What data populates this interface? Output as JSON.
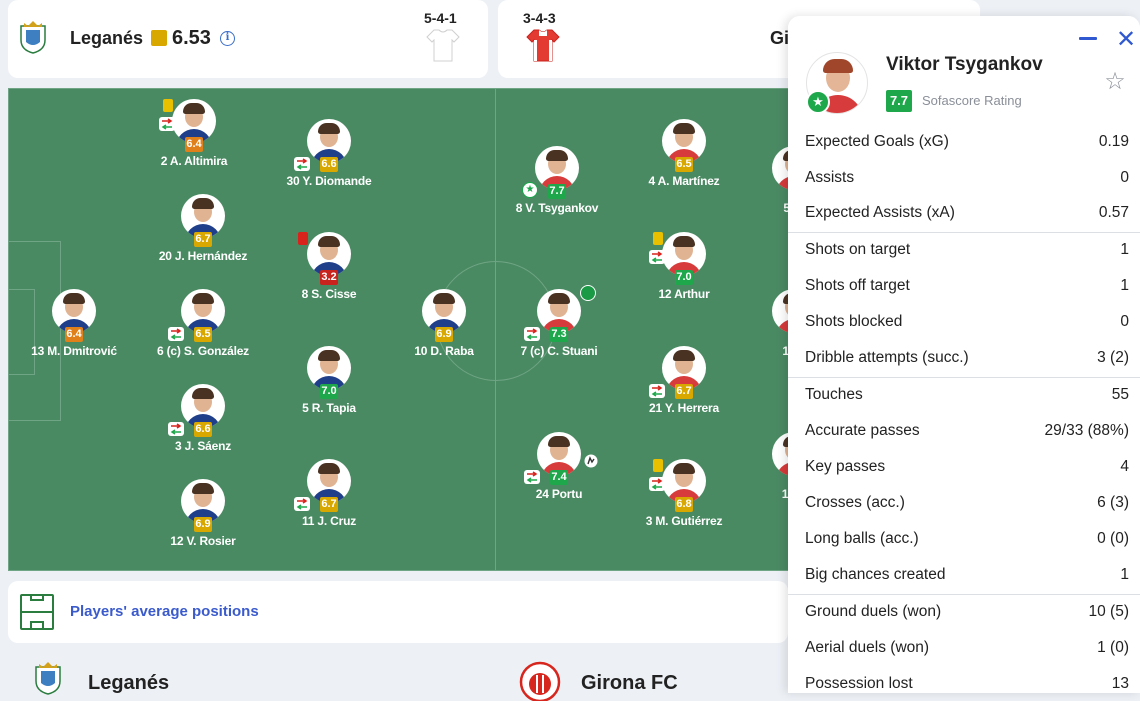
{
  "team_left": {
    "name": "Leganés",
    "rating": "6.53",
    "formation": "5-4-1"
  },
  "team_right": {
    "name_partial": "Gi",
    "formation": "3-4-3"
  },
  "colors": {
    "pitch": "#4a8a63",
    "rating_green": "#1ea84b",
    "rating_yellow": "#d8a700",
    "rating_orange": "#e0801a",
    "rating_red": "#c9231e",
    "link_blue": "#3b5bcc"
  },
  "players": [
    {
      "label": "2 A. Altimira",
      "rating": "6.4",
      "rating_color": "#e0801a",
      "icons": [
        "yellow-card",
        "substitution"
      ]
    },
    {
      "label": "30 Y. Diomande",
      "rating": "6.6",
      "rating_color": "#d8a700",
      "icons": [
        "substitution"
      ]
    },
    {
      "label": "20 J. Hernández",
      "rating": "6.7",
      "rating_color": "#d8a700",
      "icons": []
    },
    {
      "label": "8 S. Cisse",
      "rating": "3.2",
      "rating_color": "#c9231e",
      "icons": [
        "red-card"
      ]
    },
    {
      "label": "13 M. Dmitrović",
      "rating": "6.4",
      "rating_color": "#e0801a",
      "icons": []
    },
    {
      "label": "6 (c) S. González",
      "rating": "6.5",
      "rating_color": "#d8a700",
      "icons": [
        "substitution"
      ]
    },
    {
      "label": "5 R. Tapia",
      "rating": "7.0",
      "rating_color": "#1ea84b",
      "icons": []
    },
    {
      "label": "10 D. Raba",
      "rating": "6.9",
      "rating_color": "#d8a700",
      "icons": []
    },
    {
      "label": "3 J. Sáenz",
      "rating": "6.6",
      "rating_color": "#d8a700",
      "icons": [
        "substitution"
      ]
    },
    {
      "label": "11 J. Cruz",
      "rating": "6.7",
      "rating_color": "#d8a700",
      "icons": [
        "substitution"
      ]
    },
    {
      "label": "12 V. Rosier",
      "rating": "6.9",
      "rating_color": "#d8a700",
      "icons": []
    },
    {
      "label": "8 V. Tsygankov",
      "rating": "7.7",
      "rating_color": "#1ea84b",
      "icons": [
        "player-of-match"
      ]
    },
    {
      "label": "4 A. Martínez",
      "rating": "6.5",
      "rating_color": "#d8a700",
      "icons": []
    },
    {
      "label": "5 D.",
      "rating": "",
      "rating_color": "#d8a700",
      "icons": []
    },
    {
      "label": "12 Arthur",
      "rating": "7.0",
      "rating_color": "#1ea84b",
      "icons": [
        "yellow-card",
        "substitution"
      ]
    },
    {
      "label": "7 (c) C. Stuani",
      "rating": "7.3",
      "rating_color": "#1ea84b",
      "icons": [
        "substitution",
        "goal"
      ]
    },
    {
      "label": "18 L",
      "rating": "",
      "rating_color": "#d8a700",
      "icons": []
    },
    {
      "label": "21 Y. Herrera",
      "rating": "6.7",
      "rating_color": "#d8a700",
      "icons": [
        "substitution"
      ]
    },
    {
      "label": "24 Portu",
      "rating": "7.4",
      "rating_color": "#1ea84b",
      "icons": [
        "substitution",
        "assist"
      ]
    },
    {
      "label": "3 M. Gutiérrez",
      "rating": "6.8",
      "rating_color": "#d8a700",
      "icons": [
        "yellow-card",
        "substitution"
      ]
    },
    {
      "label": "17 D",
      "rating": "",
      "rating_color": "#d8a700",
      "icons": []
    }
  ],
  "avg_positions_link": "Players' average positions",
  "bottom": {
    "left_team": "Leganés",
    "right_team": "Girona FC"
  },
  "panel": {
    "player_name": "Viktor Tsygankov",
    "rating": "7.7",
    "rating_label": "Sofascore Rating",
    "stats": [
      {
        "label": "Expected Goals (xG)",
        "value": "0.19"
      },
      {
        "label": "Assists",
        "value": "0"
      },
      {
        "label": "Expected Assists (xA)",
        "value": "0.57"
      },
      {
        "label": "Shots on target",
        "value": "1"
      },
      {
        "label": "Shots off target",
        "value": "1"
      },
      {
        "label": "Shots blocked",
        "value": "0"
      },
      {
        "label": "Dribble attempts (succ.)",
        "value": "3 (2)"
      },
      {
        "label": "Touches",
        "value": "55"
      },
      {
        "label": "Accurate passes",
        "value": "29/33 (88%)"
      },
      {
        "label": "Key passes",
        "value": "4"
      },
      {
        "label": "Crosses (acc.)",
        "value": "6 (3)"
      },
      {
        "label": "Long balls (acc.)",
        "value": "0 (0)"
      },
      {
        "label": "Big chances created",
        "value": "1"
      },
      {
        "label": "Ground duels (won)",
        "value": "10 (5)"
      },
      {
        "label": "Aerial duels (won)",
        "value": "1 (0)"
      },
      {
        "label": "Possession lost",
        "value": "13"
      }
    ]
  }
}
